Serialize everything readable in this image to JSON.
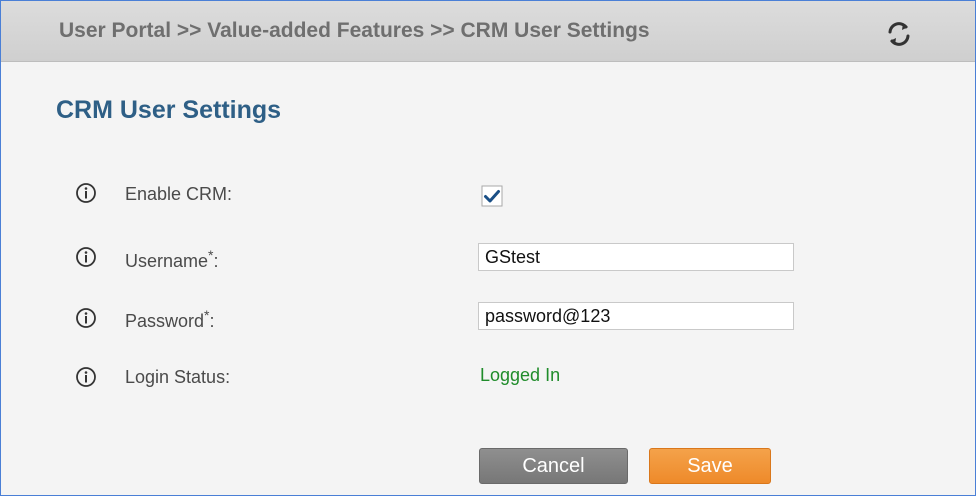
{
  "header": {
    "breadcrumb": "User Portal >> Value-added Features >> CRM User Settings",
    "refresh_icon": "refresh-icon"
  },
  "page": {
    "title": "CRM User Settings"
  },
  "form": {
    "enable_crm": {
      "label": "Enable CRM:",
      "checked": true,
      "icon": "info-icon"
    },
    "username": {
      "label": "Username",
      "required_mark": "*",
      "suffix": ":",
      "value": "GStest",
      "icon": "info-icon"
    },
    "password": {
      "label": "Password",
      "required_mark": "*",
      "suffix": ":",
      "value": "password@123",
      "icon": "info-icon"
    },
    "login_status": {
      "label": "Login Status:",
      "value": "Logged In",
      "icon": "info-icon"
    }
  },
  "buttons": {
    "cancel": "Cancel",
    "save": "Save"
  },
  "colors": {
    "title": "#2e5f86",
    "status_ok": "#1f8c2a",
    "save_button": "#f0912f",
    "cancel_button": "#808080"
  }
}
